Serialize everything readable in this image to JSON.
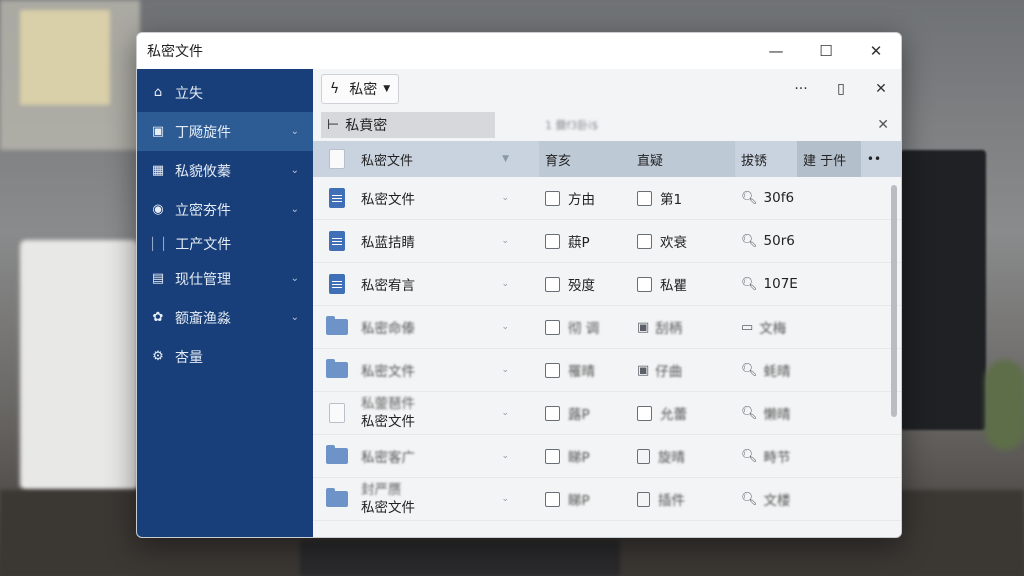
{
  "window": {
    "title": "私密文件",
    "controls": {
      "minimize": "—",
      "maximize": "☐",
      "close": "✕"
    }
  },
  "sidebar": {
    "items": [
      {
        "icon": "home-icon",
        "glyph": "⌂",
        "label": "立失",
        "chevron": false
      },
      {
        "icon": "briefcase-icon",
        "glyph": "▣",
        "label": "丁飏旋件",
        "chevron": true,
        "active": true
      },
      {
        "icon": "apps-icon",
        "glyph": "▦",
        "label": "私貌攸蓁",
        "chevron": true
      },
      {
        "icon": "compass-icon",
        "glyph": "◉",
        "label": "立密夯件",
        "chevron": true
      },
      {
        "sub": true,
        "label": "工产文件"
      },
      {
        "icon": "doc-icon",
        "glyph": "▤",
        "label": "现仕管理",
        "chevron": true
      },
      {
        "icon": "gear-icon",
        "glyph": "✿",
        "label": "额齑渔淼",
        "chevron": true
      },
      {
        "icon": "settings-icon",
        "glyph": "⚙",
        "label": "杏量",
        "chevron": false
      }
    ]
  },
  "toolbar": {
    "button_label": "私密",
    "more": "···",
    "bell": "🔔",
    "close": "✕"
  },
  "pathbar": {
    "path": "私賁密",
    "extra": "1 爨f3卧i$",
    "close": "✕"
  },
  "table": {
    "headers": {
      "name": "私密文件",
      "a": "育亥",
      "b": "直疑",
      "c": "拔锈",
      "d": "建 于件",
      "more": "••"
    },
    "rows": [
      {
        "icon": "file",
        "name": "私密文件",
        "a": "方由",
        "b": "第1",
        "c": "30f6",
        "cicon": "search",
        "bicon": "check"
      },
      {
        "icon": "file",
        "name": "私蓝拮睛",
        "a": "蕻P",
        "b": "欢衰",
        "c": "50r6",
        "cicon": "search",
        "bicon": "check"
      },
      {
        "icon": "file",
        "name": "私密宥言",
        "a": "殁度",
        "b": "私瞿",
        "c": "107E",
        "cicon": "search",
        "bicon": "check"
      },
      {
        "icon": "folder",
        "name": "私密命傣",
        "a": "彻 调",
        "b": "刮柄",
        "c": "文梅",
        "cicon": "folder",
        "bicon": "image",
        "fade": true
      },
      {
        "icon": "folder",
        "name": "私密文件",
        "a": "罹晴",
        "b": "仔曲",
        "c": "蚝晴",
        "cicon": "search",
        "bicon": "image",
        "fade": true
      },
      {
        "icon": "blank",
        "name": "私密文件",
        "top": "私蓥琶件",
        "a": "蕗P",
        "b": "允蕾",
        "c": "懒晴",
        "cicon": "search",
        "bicon": "check",
        "fade": true
      },
      {
        "icon": "folder",
        "name": "私密客广",
        "a": "睇P",
        "b": "旋晴",
        "c": "畤节",
        "cicon": "search",
        "bicon": "doc",
        "fade": true
      },
      {
        "icon": "folder",
        "name": "私密文件",
        "top": "封严赝",
        "a": "睇P",
        "b": "插件",
        "c": "文楼",
        "cicon": "search",
        "bicon": "doc",
        "fade": true
      }
    ]
  }
}
